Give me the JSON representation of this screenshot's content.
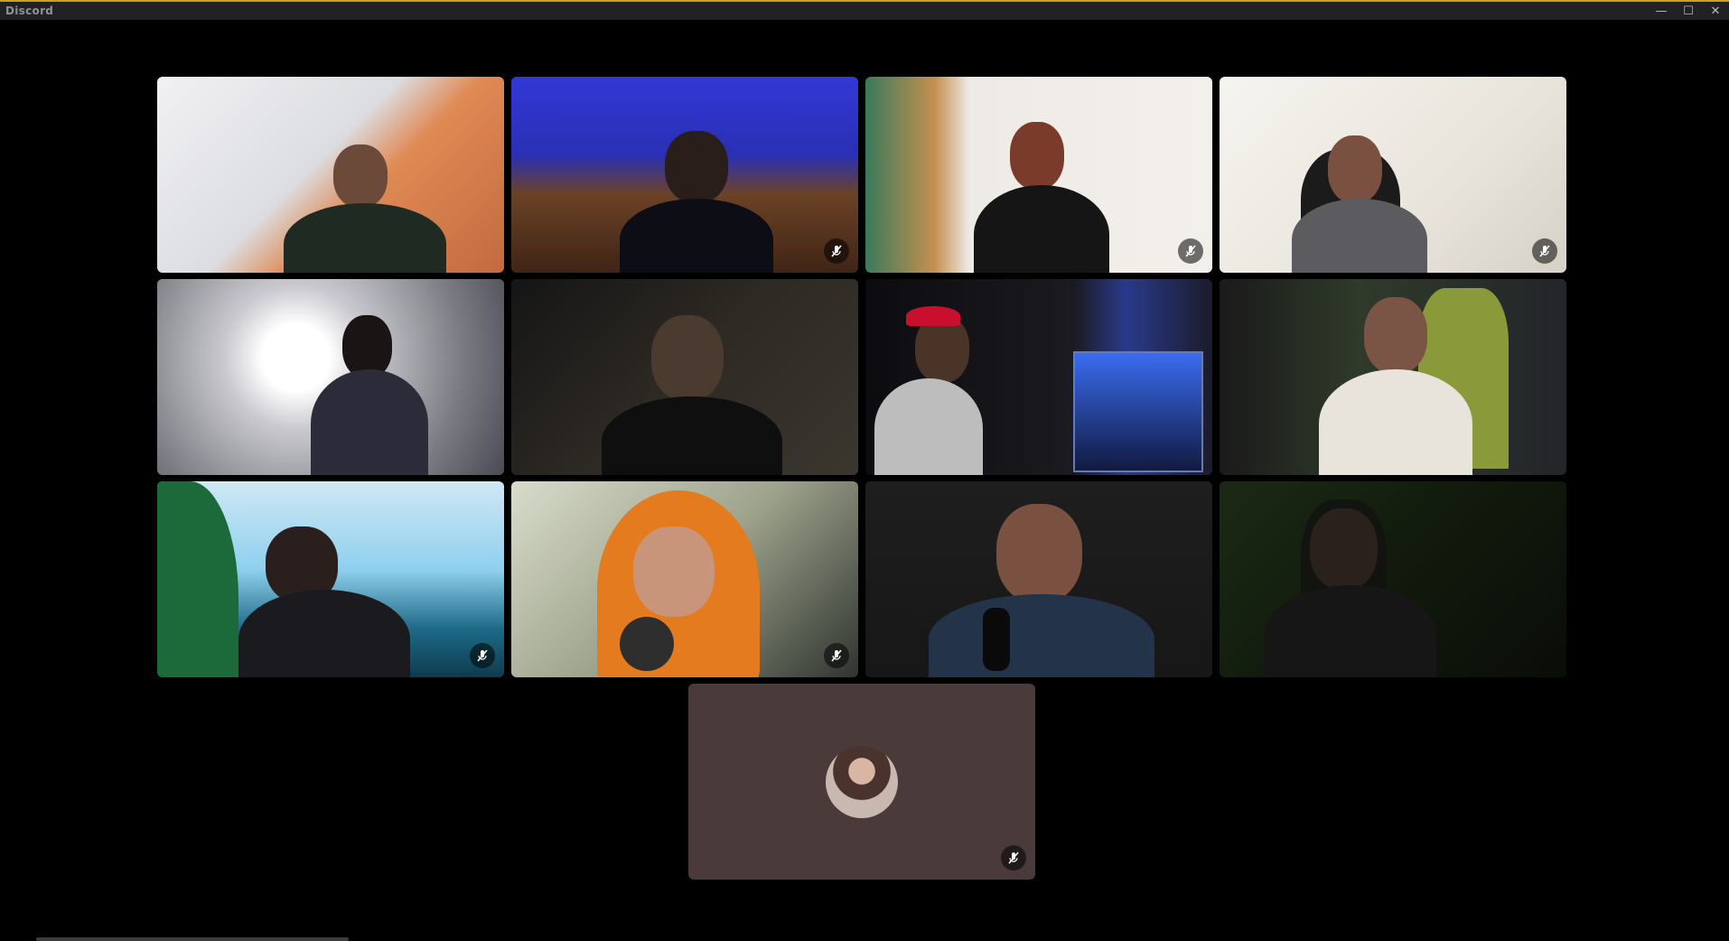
{
  "window": {
    "title": "Discord",
    "controls": {
      "minimize": "—",
      "maximize": "☐",
      "close": "✕"
    }
  },
  "colors": {
    "accent": "#c9a227",
    "speaking_ring": "#43b581",
    "self_tile_bg": "#4a3a3a"
  },
  "participants": [
    {
      "tile": 1,
      "muted": false,
      "speaking": false,
      "camera": true
    },
    {
      "tile": 2,
      "muted": true,
      "speaking": false,
      "camera": true
    },
    {
      "tile": 3,
      "muted": true,
      "speaking": false,
      "camera": true
    },
    {
      "tile": 4,
      "muted": true,
      "speaking": false,
      "camera": true
    },
    {
      "tile": 5,
      "muted": false,
      "speaking": true,
      "camera": true
    },
    {
      "tile": 6,
      "muted": false,
      "speaking": false,
      "camera": true
    },
    {
      "tile": 7,
      "muted": false,
      "speaking": false,
      "camera": true
    },
    {
      "tile": 8,
      "muted": false,
      "speaking": false,
      "camera": true
    },
    {
      "tile": 9,
      "muted": true,
      "speaking": false,
      "camera": true
    },
    {
      "tile": 10,
      "muted": true,
      "speaking": false,
      "camera": true
    },
    {
      "tile": 11,
      "muted": false,
      "speaking": false,
      "camera": true
    },
    {
      "tile": 12,
      "muted": false,
      "speaking": false,
      "camera": true
    },
    {
      "tile": 13,
      "muted": true,
      "speaking": false,
      "camera": false
    }
  ],
  "icons": {
    "mute": "microphone-muted-icon"
  }
}
